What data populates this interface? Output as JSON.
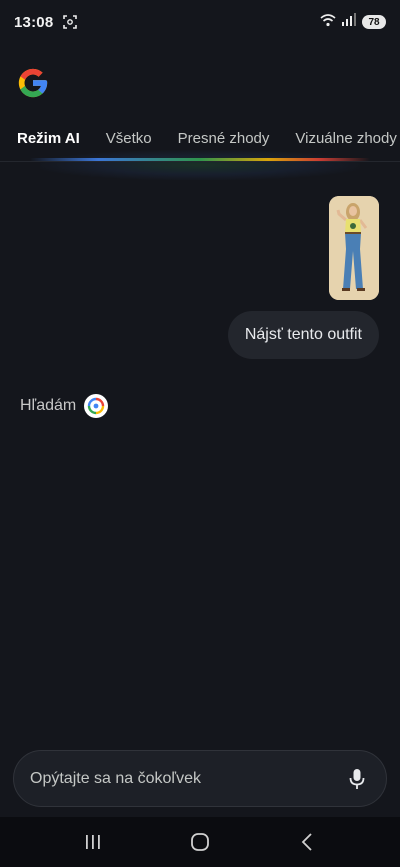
{
  "status_bar": {
    "time": "13:08",
    "battery": "78",
    "icons": [
      "screenshot-icon",
      "wifi-icon",
      "signal-icon",
      "battery-icon"
    ]
  },
  "app": {
    "logo": "google-logo"
  },
  "tabs": [
    {
      "label": "Režim AI",
      "active": true
    },
    {
      "label": "Všetko",
      "active": false
    },
    {
      "label": "Presné zhody",
      "active": false
    },
    {
      "label": "Vizuálne zhody",
      "active": false
    }
  ],
  "conversation": {
    "image_description_icon": "query-image",
    "user_message": "Nájsť tento outfit",
    "status_text": "Hľadám"
  },
  "input": {
    "placeholder": "Opýtajte sa na čokoľvek",
    "value": ""
  },
  "colors": {
    "background": "#14161c",
    "bubble": "#23262d",
    "blue": "#4285f4",
    "red": "#ea4335",
    "yellow": "#fbbc05",
    "green": "#34a853"
  }
}
